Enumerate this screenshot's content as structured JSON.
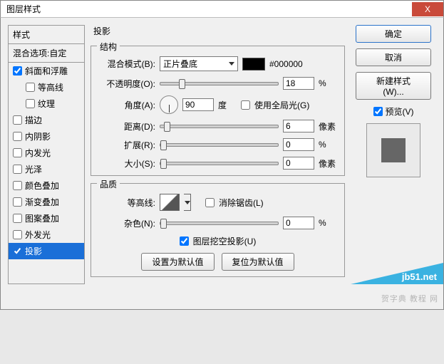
{
  "titlebar": {
    "title": "图层样式",
    "close": "X"
  },
  "styles": {
    "header": "样式",
    "blend_defaults": "混合选项:自定",
    "items": [
      {
        "label": "斜面和浮雕",
        "checked": true,
        "indent": false
      },
      {
        "label": "等高线",
        "checked": false,
        "indent": true
      },
      {
        "label": "纹理",
        "checked": false,
        "indent": true
      },
      {
        "label": "描边",
        "checked": false,
        "indent": false
      },
      {
        "label": "内阴影",
        "checked": false,
        "indent": false
      },
      {
        "label": "内发光",
        "checked": false,
        "indent": false
      },
      {
        "label": "光泽",
        "checked": false,
        "indent": false
      },
      {
        "label": "颜色叠加",
        "checked": false,
        "indent": false
      },
      {
        "label": "渐变叠加",
        "checked": false,
        "indent": false
      },
      {
        "label": "图案叠加",
        "checked": false,
        "indent": false
      },
      {
        "label": "外发光",
        "checked": false,
        "indent": false
      },
      {
        "label": "投影",
        "checked": true,
        "indent": false,
        "selected": true
      }
    ]
  },
  "panel": {
    "title": "投影",
    "structure": {
      "legend": "结构",
      "blend_mode_label": "混合模式(B):",
      "blend_mode_value": "正片叠底",
      "color_hex": "#000000",
      "opacity_label": "不透明度(O):",
      "opacity_value": "18",
      "opacity_unit": "%",
      "angle_label": "角度(A):",
      "angle_value": "90",
      "angle_unit": "度",
      "global_light_label": "使用全局光(G)",
      "distance_label": "距离(D):",
      "distance_value": "6",
      "distance_unit": "像素",
      "spread_label": "扩展(R):",
      "spread_value": "0",
      "spread_unit": "%",
      "size_label": "大小(S):",
      "size_value": "0",
      "size_unit": "像素"
    },
    "quality": {
      "legend": "品质",
      "contour_label": "等高线:",
      "antialias_label": "消除锯齿(L)",
      "noise_label": "杂色(N):",
      "noise_value": "0",
      "noise_unit": "%"
    },
    "knockout_label": "图层挖空投影(U)",
    "make_default": "设置为默认值",
    "reset_default": "复位为默认值"
  },
  "right": {
    "ok": "确定",
    "cancel": "取消",
    "new_style": "新建样式(W)...",
    "preview_label": "预览(V)"
  },
  "watermark_text": "贺字典  教程 网",
  "watermark_brand": "jb51.net"
}
